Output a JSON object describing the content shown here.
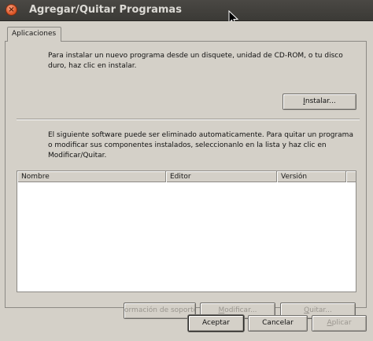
{
  "window": {
    "title": "Agregar/Quitar Programas",
    "close_glyph": "×"
  },
  "tabs": [
    {
      "label": "Aplicaciones"
    }
  ],
  "install_section": {
    "description": "Para instalar un nuevo programa desde un disquete, unidad de CD-ROM, o tu disco duro, haz clic en instalar.",
    "install_button": {
      "mnemonic": "I",
      "rest": "nstalar..."
    }
  },
  "remove_section": {
    "description": "El siguiente software puede ser eliminado automaticamente. Para quitar un programa o modificar sus componentes instalados, seleccionanlo en la lista y haz clic en Modificar/Quitar."
  },
  "software_list": {
    "columns": [
      "Nombre",
      "Editor",
      "Versión"
    ],
    "rows": []
  },
  "list_buttons": {
    "support": "ormación de soporte",
    "modify": {
      "mnemonic": "M",
      "rest": "odificar..."
    },
    "remove": {
      "mnemonic": "Q",
      "rest": "uitar..."
    }
  },
  "dialog_buttons": {
    "accept": "Aceptar",
    "cancel": "Cancelar",
    "apply": {
      "mnemonic": "A",
      "rest": "plicar"
    }
  }
}
